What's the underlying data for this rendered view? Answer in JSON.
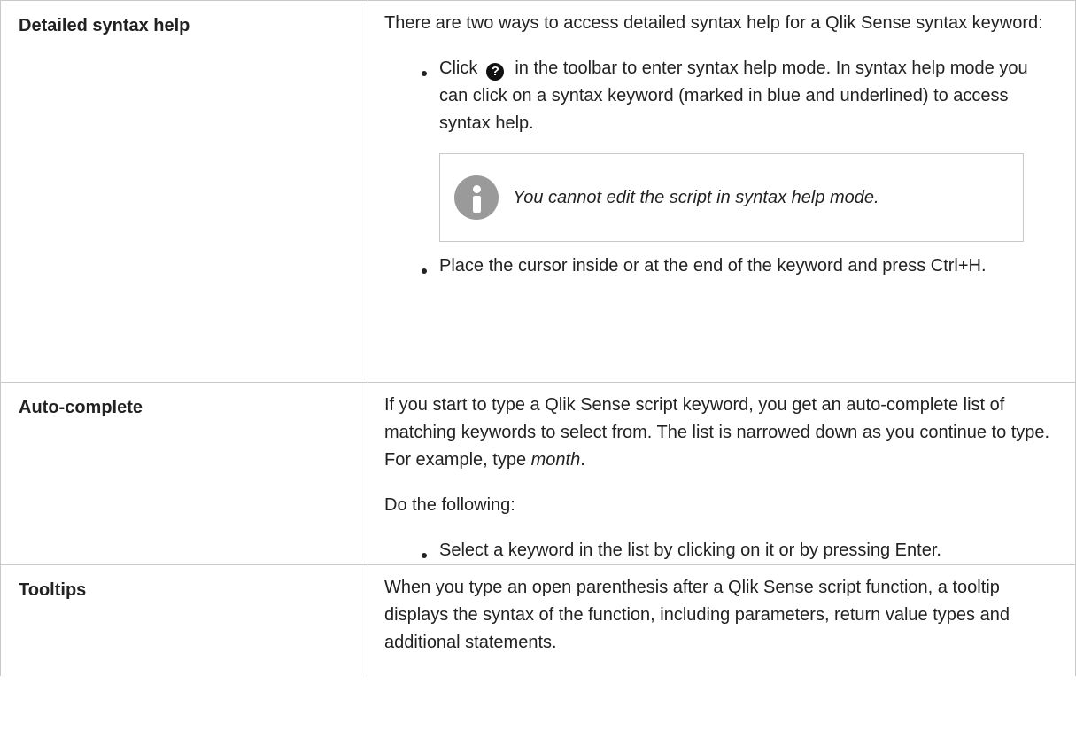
{
  "rows": [
    {
      "term": "Detailed syntax help",
      "intro": "There are two ways to access detailed syntax help for a Qlik Sense syntax keyword:",
      "bullet1_prefix": "Click",
      "help_icon": {
        "name": "question-circle-icon",
        "glyph": "?"
      },
      "bullet1_suffix": "in the toolbar to enter syntax help mode. In syntax help mode you can click on a syntax keyword (marked in blue and underlined) to access syntax help.",
      "note": {
        "icon": "info-icon",
        "text": "You cannot edit the script in syntax help mode."
      },
      "bullet2": "Place the cursor inside or at the end of the keyword and press Ctrl+H."
    },
    {
      "term": "Auto-complete",
      "intro": "If you start to type a Qlik Sense script keyword, you get an auto-complete list of matching keywords to select from. The list is narrowed down as you continue to type. For example, type ",
      "intro_emphasis": "month",
      "intro_end": ".",
      "lead": "Do the following:",
      "bullet1": "Select a keyword in the list by clicking on it or by pressing Enter."
    },
    {
      "term": "Tooltips",
      "text": "When you type an open parenthesis after a Qlik Sense script function, a tooltip displays the syntax of the function, including parameters, return value types and additional statements."
    }
  ]
}
